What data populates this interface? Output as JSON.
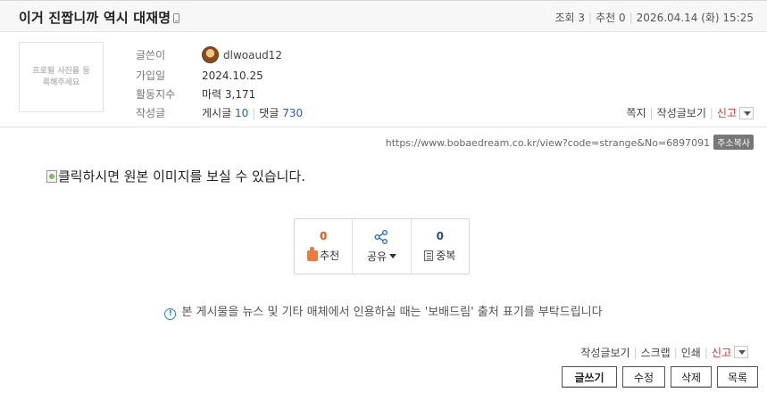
{
  "post": {
    "title": "이거 진짭니까 역시 대재명",
    "views_label": "조회 3",
    "recommend_label": "추천 0",
    "datetime": "2026.04.14 (화) 15:25"
  },
  "profile": {
    "photo_placeholder": "프로필 사진을 등록해주세요",
    "author_label": "글쓴이",
    "author_nick": "dlwoaud12",
    "joined_label": "가입일",
    "joined_value": "2024.10.25",
    "activity_label": "활동지수",
    "activity_value": "마력 3,171",
    "posts_label": "작성글",
    "posts_prefix": "게시글",
    "posts_count": "10",
    "comments_prefix": "댓글",
    "comments_count": "730",
    "actions": {
      "message": "쪽지",
      "view_posts": "작성글보기",
      "report": "신고"
    }
  },
  "url": {
    "text": "https://www.bobaedream.co.kr/view?code=strange&No=6897091",
    "copy_label": "주소복사"
  },
  "content": {
    "image_alt": "클릭하시면 원본 이미지를 보실 수 있습니다."
  },
  "votes": {
    "recommend": {
      "count": "0",
      "label": "추천"
    },
    "share": {
      "label": "공유"
    },
    "duplicate": {
      "count": "0",
      "label": "중복"
    }
  },
  "notice": "본 게시물을 뉴스 및 기타 매체에서 인용하실 때는 '보배드림' 출처 표기를 부탁드립니다",
  "bottom": {
    "view_posts": "작성글보기",
    "scrap": "스크랩",
    "print": "인쇄",
    "report": "신고",
    "buttons": {
      "write": "글쓰기",
      "edit": "수정",
      "delete": "삭제",
      "list": "목록"
    }
  },
  "colors": {
    "accent_blue": "#2a5db0",
    "report_red": "#d9312b",
    "recommend_orange": "#e6550f"
  },
  "icons": [
    "mobile-icon",
    "avatar",
    "dropdown-icon",
    "broken-image-icon",
    "thumbs-up-icon",
    "share-icon",
    "duplicate-icon",
    "info-icon"
  ]
}
